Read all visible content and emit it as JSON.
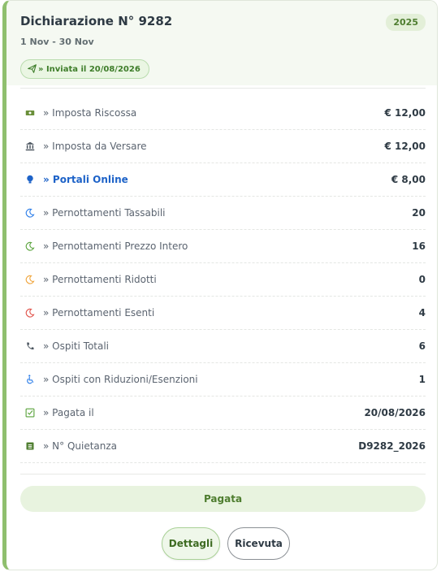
{
  "header": {
    "title": "Dichiarazione N° 9282",
    "period": "1 Nov - 30 Nov",
    "year": "2025",
    "sent_badge": "» Inviata il 20/08/2026"
  },
  "rows": [
    {
      "label": "» Imposta Riscossa",
      "value": "€ 12,00",
      "icon": "money-icon",
      "color": "#6a8f3a"
    },
    {
      "label": "» Imposta da Versare",
      "value": "€ 12,00",
      "icon": "bank-icon",
      "color": "#4c5660"
    },
    {
      "label": "» Portali Online",
      "value": "€ 8,00",
      "icon": "bulb-icon",
      "color": "#1e63c8",
      "highlight": true
    },
    {
      "label": "» Pernottamenti Tassabili",
      "value": "20",
      "icon": "moon-icon",
      "color": "#2b7de9"
    },
    {
      "label": "» Pernottamenti Prezzo Intero",
      "value": "16",
      "icon": "moon-icon",
      "color": "#5aa33c"
    },
    {
      "label": "» Pernottamenti Ridotti",
      "value": "0",
      "icon": "moon-icon",
      "color": "#f0a43a"
    },
    {
      "label": "» Pernottamenti Esenti",
      "value": "4",
      "icon": "moon-icon",
      "color": "#e0524a"
    },
    {
      "label": "» Ospiti Totali",
      "value": "6",
      "icon": "phone-icon",
      "color": "#4c5660"
    },
    {
      "label": "» Ospiti con Riduzioni/Esenzioni",
      "value": "1",
      "icon": "wheelchair-icon",
      "color": "#2b7de9"
    },
    {
      "label": "» Pagata il",
      "value": "20/08/2026",
      "icon": "checkbox-icon",
      "color": "#5aa33c"
    },
    {
      "label": "» N° Quietanza",
      "value": "D9282_2026",
      "icon": "receipt-icon",
      "color": "#4e7d2f"
    }
  ],
  "status": "Pagata",
  "buttons": {
    "details": "Dettagli",
    "receipt": "Ricevuta"
  }
}
